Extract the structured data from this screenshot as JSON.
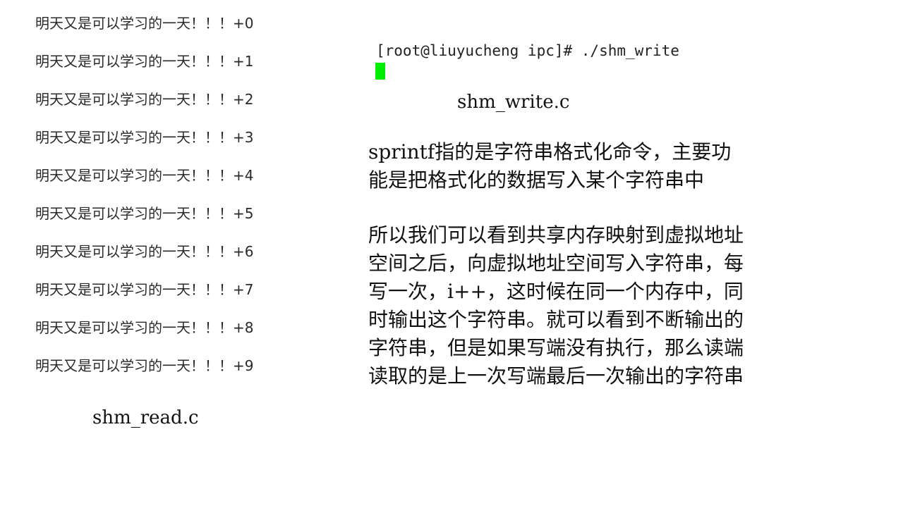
{
  "output": {
    "lines": [
      {
        "text": "明天又是可以学习的一天！！！",
        "suffix": "+0"
      },
      {
        "text": "明天又是可以学习的一天！！！",
        "suffix": "+1"
      },
      {
        "text": "明天又是可以学习的一天！！！",
        "suffix": "+2"
      },
      {
        "text": "明天又是可以学习的一天！！！",
        "suffix": "+3"
      },
      {
        "text": "明天又是可以学习的一天！！！",
        "suffix": "+4"
      },
      {
        "text": "明天又是可以学习的一天！！！",
        "suffix": "+5"
      },
      {
        "text": "明天又是可以学习的一天！！！",
        "suffix": "+6"
      },
      {
        "text": "明天又是可以学习的一天！！！",
        "suffix": "+7"
      },
      {
        "text": "明天又是可以学习的一天！！！",
        "suffix": "+8"
      },
      {
        "text": "明天又是可以学习的一天！！！",
        "suffix": "+9"
      }
    ]
  },
  "captions": {
    "read": "shm_read.c",
    "write": "shm_write.c"
  },
  "terminal": {
    "prompt": "[root@liuyucheng ipc]# ./shm_write",
    "cursor_color": "#00ee00"
  },
  "explanation": {
    "para1": [
      "sprintf指的是字符串格式化命令，主要功",
      "能是把格式化的数据写入某个字符串中"
    ],
    "para2": [
      "所以我们可以看到共享内存映射到虚拟地址",
      "空间之后，向虚拟地址空间写入字符串，每",
      "写一次，i++，这时候在同一个内存中，同",
      "时输出这个字符串。就可以看到不断输出的",
      "字符串，但是如果写端没有执行，那么读端",
      "读取的是上一次写端最后一次输出的字符串"
    ]
  }
}
